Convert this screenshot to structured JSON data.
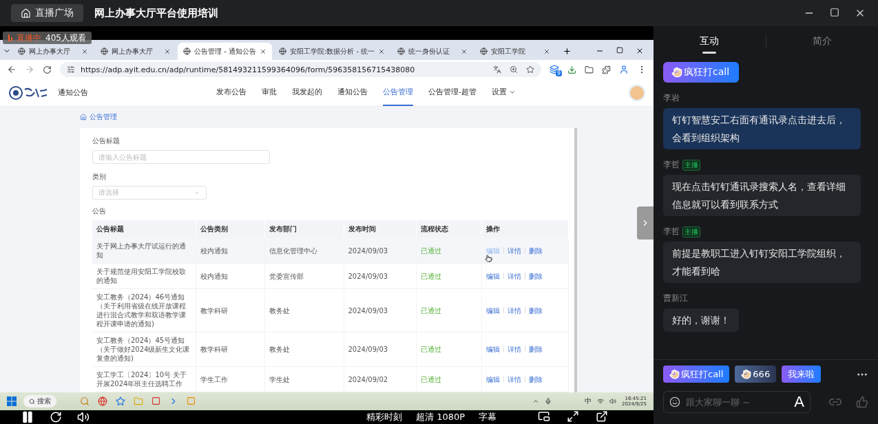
{
  "window": {
    "title": "网上办事大厅平台使用培训",
    "home_button": "直播广场"
  },
  "live": {
    "status": "直播中",
    "viewers": "405人观看"
  },
  "browser": {
    "tabs": [
      {
        "label": "网上办事大厅",
        "selected": false
      },
      {
        "label": "网上办事大厅",
        "selected": false
      },
      {
        "label": "公告管理 - 通知公告",
        "selected": true
      },
      {
        "label": "安阳工学院:数据分析 - 统一",
        "selected": false
      },
      {
        "label": "统一身份认证",
        "selected": false
      },
      {
        "label": "安阳工学院",
        "selected": false
      }
    ],
    "url": "https://adp.ayit.edu.cn/adp/runtime/581493211599364096/form/596358156715438080",
    "extension_badge": "9"
  },
  "app": {
    "section": "通知公告",
    "nav": [
      {
        "label": "发布公告",
        "selected": false,
        "menu": false
      },
      {
        "label": "审批",
        "selected": false,
        "menu": false
      },
      {
        "label": "我发起的",
        "selected": false,
        "menu": false
      },
      {
        "label": "通知公告",
        "selected": false,
        "menu": false
      },
      {
        "label": "公告管理",
        "selected": true,
        "menu": false
      },
      {
        "label": "公告管理-超管",
        "selected": false,
        "menu": false
      },
      {
        "label": "设置",
        "selected": false,
        "menu": true
      }
    ],
    "breadcrumb": "公告管理",
    "form": {
      "title_label": "公告标题",
      "title_placeholder": "请输入公告标题",
      "category_label": "类别",
      "category_placeholder": "请选择",
      "table_label": "公告"
    },
    "table": {
      "columns": [
        "公告标题",
        "公告类别",
        "发布部门",
        "发布时间",
        "流程状态",
        "操作"
      ],
      "rows": [
        {
          "title": "关于网上办事大厅试运行的通知",
          "category": "校内通知",
          "department": "信息化管理中心",
          "date": "2024/09/03",
          "status": "已通过",
          "actions": [
            "编辑",
            "详情",
            "删除"
          ],
          "hovered": true
        },
        {
          "title": "关于规范使用安阳工学院校歌的通知",
          "category": "校内通知",
          "department": "党委宣传部",
          "date": "2024/09/03",
          "status": "已通过",
          "actions": [
            "编辑",
            "详情",
            "删除"
          ],
          "hovered": false
        },
        {
          "title": "安工教务（2024）46号通知（关于利用省级在线开放课程进行混合式教学和双语教学课程开课申请的通知)",
          "category": "教学科研",
          "department": "教务处",
          "date": "2024/09/03",
          "status": "已通过",
          "actions": [
            "编辑",
            "详情",
            "删除"
          ],
          "hovered": false
        },
        {
          "title": "安工教务（2024）45号通知（关于做好2024级新生文化课复查的通知)",
          "category": "教学科研",
          "department": "教务处",
          "date": "2024/09/03",
          "status": "已通过",
          "actions": [
            "编辑",
            "详情",
            "删除"
          ],
          "hovered": false
        },
        {
          "title": "安工学工〔2024〕10号 关于开展2024年班主任选聘工作",
          "category": "学生工作",
          "department": "学生处",
          "date": "2024/09/02",
          "status": "已通过",
          "actions": [
            "编辑",
            "详情",
            "删除"
          ],
          "hovered": false
        }
      ]
    }
  },
  "desktop_taskbar": {
    "search": "搜索",
    "ime": "中",
    "time": "16:45:21",
    "date": "2024/9/25"
  },
  "player": {
    "buttons": [
      "精彩时刻",
      "超清 1080P",
      "字幕"
    ]
  },
  "chat": {
    "tabs": [
      {
        "label": "互动",
        "selected": true
      },
      {
        "label": "简介",
        "selected": false
      }
    ],
    "messages": [
      {
        "kind": "gift",
        "text": "疯狂打call"
      },
      {
        "kind": "message",
        "author": "李岩",
        "text": "钉钉智慧安工右面有通讯录点击进去后，会看到组织架构",
        "highlighted": true
      },
      {
        "kind": "message",
        "author": "李哲",
        "badge": "主播",
        "text": "现在点击钉钉通讯录搜索人名，查看详细信息就可以看到联系方式",
        "highlighted": false
      },
      {
        "kind": "message",
        "author": "李哲",
        "badge": "主播",
        "text": "前提是教职工进入钉钉安阳工学院组织，才能看到哈",
        "highlighted": false
      },
      {
        "kind": "message",
        "author": "曹新江",
        "text": "好的，谢谢！",
        "highlighted": false
      }
    ],
    "quick_replies": [
      {
        "text": "疯狂打call",
        "kind": "bright",
        "hand": true
      },
      {
        "text": "666",
        "kind": "dim",
        "hand": true
      },
      {
        "text": "我来啦",
        "kind": "bright",
        "hand": false
      }
    ],
    "input": {
      "placeholder": "跟大家聊一聊 ~",
      "font_button": "A"
    }
  }
}
